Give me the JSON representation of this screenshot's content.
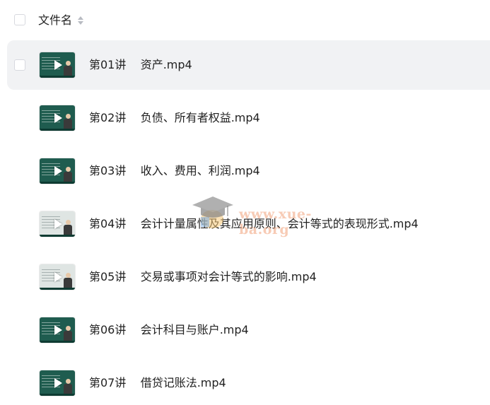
{
  "header": {
    "column_label": "文件名"
  },
  "files": [
    {
      "lecture": "第01讲",
      "name": "资产.mp4",
      "thumb_style": "dark",
      "hovered": true
    },
    {
      "lecture": "第02讲",
      "name": "负债、所有者权益.mp4",
      "thumb_style": "dark",
      "hovered": false
    },
    {
      "lecture": "第03讲",
      "name": "收入、费用、利润.mp4",
      "thumb_style": "dark",
      "hovered": false
    },
    {
      "lecture": "第04讲",
      "name": "会计计量属性及其应用原则、会计等式的表现形式.mp4",
      "thumb_style": "light",
      "hovered": false
    },
    {
      "lecture": "第05讲",
      "name": "交易或事项对会计等式的影响.mp4",
      "thumb_style": "light",
      "hovered": false
    },
    {
      "lecture": "第06讲",
      "name": "会计科目与账户.mp4",
      "thumb_style": "dark",
      "hovered": false
    },
    {
      "lecture": "第07讲",
      "name": "借贷记账法.mp4",
      "thumb_style": "dark",
      "hovered": false
    }
  ],
  "watermark": {
    "text": "www.xue-ba.org"
  },
  "icons": {
    "header_checkbox": "checkbox-icon",
    "sort": "sort-icon",
    "thumbnail_play": "play-icon",
    "watermark_logo": "graduation-cap-icon"
  },
  "colors": {
    "hover_row_bg": "#f1f2f4",
    "thumb_dark": "#1f5c4f",
    "thumb_light": "#dfe5e3",
    "text": "#222222",
    "watermark_text": "#f0a078"
  }
}
